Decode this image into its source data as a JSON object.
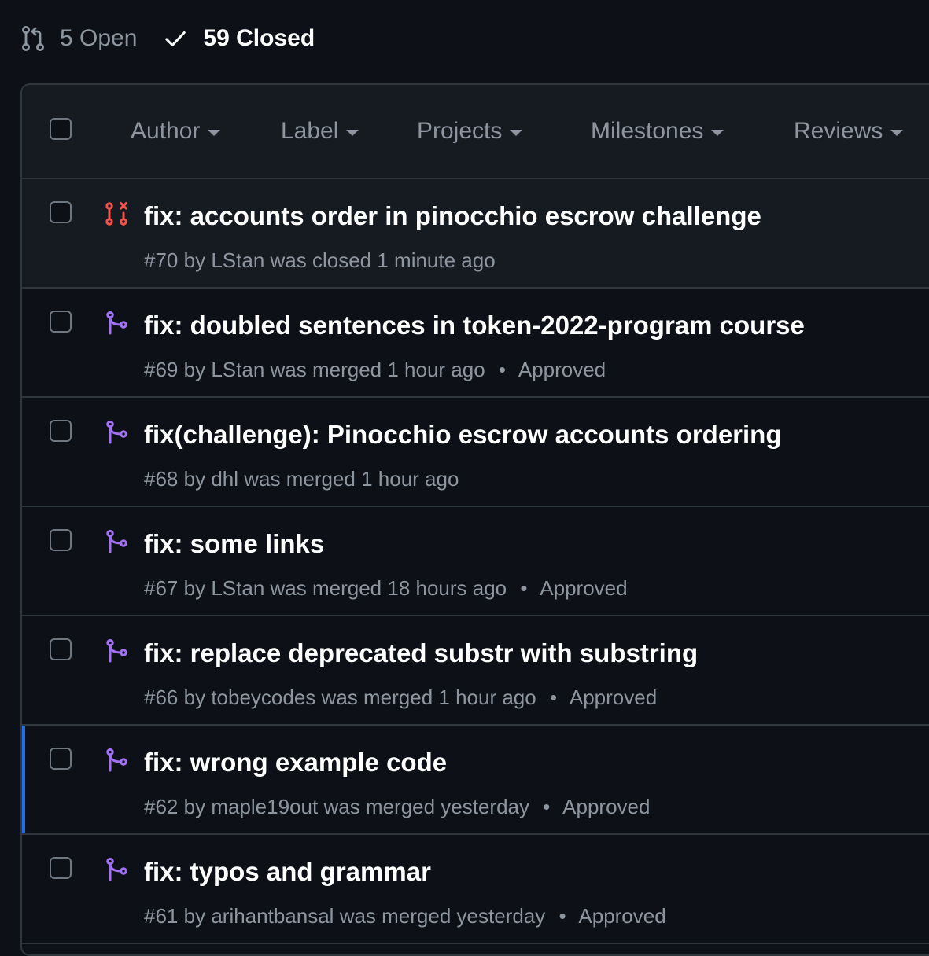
{
  "states": {
    "open_label": "5 Open",
    "closed_label": "59 Closed"
  },
  "filters": {
    "author": "Author",
    "label": "Label",
    "projects": "Projects",
    "milestones": "Milestones",
    "reviews": "Reviews"
  },
  "colors": {
    "closed_icon": "#f85149",
    "merged_icon": "#a371f7",
    "selected_accent": "#1f6feb"
  },
  "pull_requests": [
    {
      "title": "fix: accounts order in pinocchio escrow challenge",
      "number": "#70",
      "by_prefix": "by",
      "author": "LStan",
      "status_text": "was closed 1 minute ago",
      "review": "",
      "state": "closed-icon"
    },
    {
      "title": "fix: doubled sentences in token-2022-program course",
      "number": "#69",
      "by_prefix": "by",
      "author": "LStan",
      "status_text": "was merged 1 hour ago",
      "review": "Approved",
      "state": "merged-icon"
    },
    {
      "title": "fix(challenge): Pinocchio escrow accounts ordering",
      "number": "#68",
      "by_prefix": "by",
      "author": "dhl",
      "status_text": "was merged 1 hour ago",
      "review": "",
      "state": "merged-icon"
    },
    {
      "title": "fix: some links",
      "number": "#67",
      "by_prefix": "by",
      "author": "LStan",
      "status_text": "was merged 18 hours ago",
      "review": "Approved",
      "state": "merged-icon"
    },
    {
      "title": "fix: replace deprecated substr with substring",
      "number": "#66",
      "by_prefix": "by",
      "author": "tobeycodes",
      "status_text": "was merged 1 hour ago",
      "review": "Approved",
      "state": "merged-icon"
    },
    {
      "title": "fix: wrong example code",
      "number": "#62",
      "by_prefix": "by",
      "author": "maple19out",
      "status_text": "was merged yesterday",
      "review": "Approved",
      "state": "merged-icon"
    },
    {
      "title": "fix: typos and grammar",
      "number": "#61",
      "by_prefix": "by",
      "author": "arihantbansal",
      "status_text": "was merged yesterday",
      "review": "Approved",
      "state": "merged-icon"
    }
  ]
}
